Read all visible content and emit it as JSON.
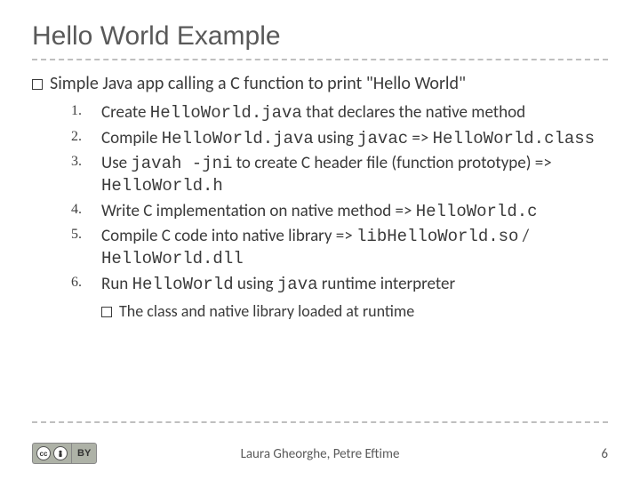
{
  "title": "Hello World Example",
  "intro_prefix": "Simple Java app calling a C function to print ",
  "intro_quote": "\"Hello World\"",
  "steps": {
    "s1_a": "Create ",
    "s1_b": "HelloWorld.java",
    "s1_c": " that declares the native method",
    "s2_a": "Compile ",
    "s2_b": "HelloWorld.java",
    "s2_c": " using ",
    "s2_d": "javac",
    "s2_e": " => ",
    "s2_f": "HelloWorld.class",
    "s3_a": "Use ",
    "s3_b": "javah -jni",
    "s3_c": " to create C header file (function prototype) => ",
    "s3_d": "HelloWorld.h",
    "s4_a": "Write C implementation on native method => ",
    "s4_b": "HelloWorld.c",
    "s5_a": "Compile C code into native library => ",
    "s5_b": "libHelloWorld.so",
    "s5_c": " / ",
    "s5_d": "HelloWorld.dll",
    "s6_a": "Run ",
    "s6_b": "HelloWorld",
    "s6_c": " using ",
    "s6_d": "java",
    "s6_e": " runtime interpreter"
  },
  "subnote": "The class and native library loaded at runtime",
  "cc": {
    "left1": "cc",
    "left2": "①",
    "right": "BY"
  },
  "authors": "Laura Gheorghe, Petre Eftime",
  "page": "6"
}
